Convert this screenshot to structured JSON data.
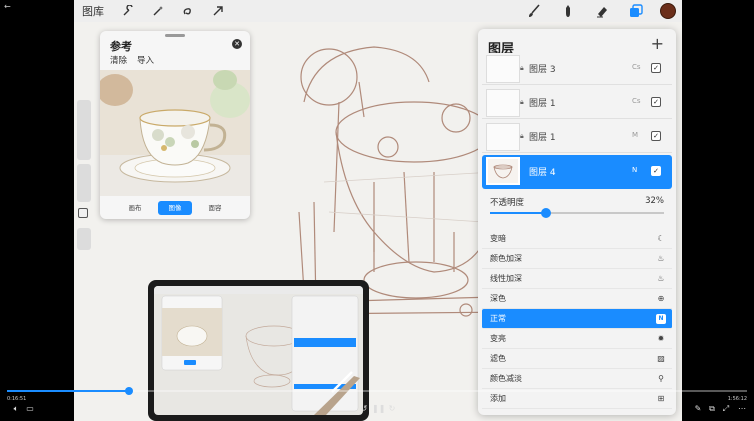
{
  "topbar": {
    "gallery_label": "图库",
    "left_tools": [
      "wrench-icon",
      "magic-wand-icon",
      "selection-icon",
      "transform-arrow-icon"
    ],
    "right_tools": [
      "brush-icon",
      "smudge-icon",
      "eraser-icon",
      "layers-icon"
    ],
    "color_swatch": "#6b2e1a"
  },
  "reference": {
    "title": "参考",
    "actions": [
      "清除",
      "导入"
    ],
    "tabs": [
      {
        "label": "画布",
        "active": false
      },
      {
        "label": "图像",
        "active": true
      },
      {
        "label": "面容",
        "active": false
      }
    ]
  },
  "layers": {
    "title": "图层",
    "add_label": "+",
    "rows": [
      {
        "name": "图层 3",
        "mode": "Cs",
        "locked": true,
        "visible": true,
        "active": false
      },
      {
        "name": "图层 1",
        "mode": "Cs",
        "locked": true,
        "visible": true,
        "active": false
      },
      {
        "name": "图层 1",
        "mode": "M",
        "locked": true,
        "visible": true,
        "active": false
      },
      {
        "name": "图层 4",
        "mode": "N",
        "locked": false,
        "visible": true,
        "active": true
      }
    ],
    "opacity_label": "不透明度",
    "opacity_value": "32%",
    "opacity_fraction": 0.32,
    "blend_modes": [
      {
        "label": "变暗",
        "icon": "moon-icon",
        "glyph": "☾",
        "active": false
      },
      {
        "label": "颜色加深",
        "icon": "flame-icon",
        "glyph": "♨",
        "active": false
      },
      {
        "label": "线性加深",
        "icon": "flame-outline-icon",
        "glyph": "♨",
        "active": false
      },
      {
        "label": "深色",
        "icon": "plus-circle-icon",
        "glyph": "⊕",
        "active": false
      },
      {
        "label": "正常",
        "icon": "n-badge-icon",
        "glyph": "N",
        "active": true
      },
      {
        "label": "变亮",
        "icon": "sun-icon",
        "glyph": "✹",
        "active": false
      },
      {
        "label": "滤色",
        "icon": "stripes-icon",
        "glyph": "▨",
        "active": false
      },
      {
        "label": "颜色减淡",
        "icon": "dodge-icon",
        "glyph": "⚲",
        "active": false
      },
      {
        "label": "添加",
        "icon": "plus-box-icon",
        "glyph": "⊞",
        "active": false
      }
    ]
  },
  "player": {
    "current_time": "0:16:51",
    "total_time": "1:56:12",
    "progress_fraction": 0.165
  }
}
